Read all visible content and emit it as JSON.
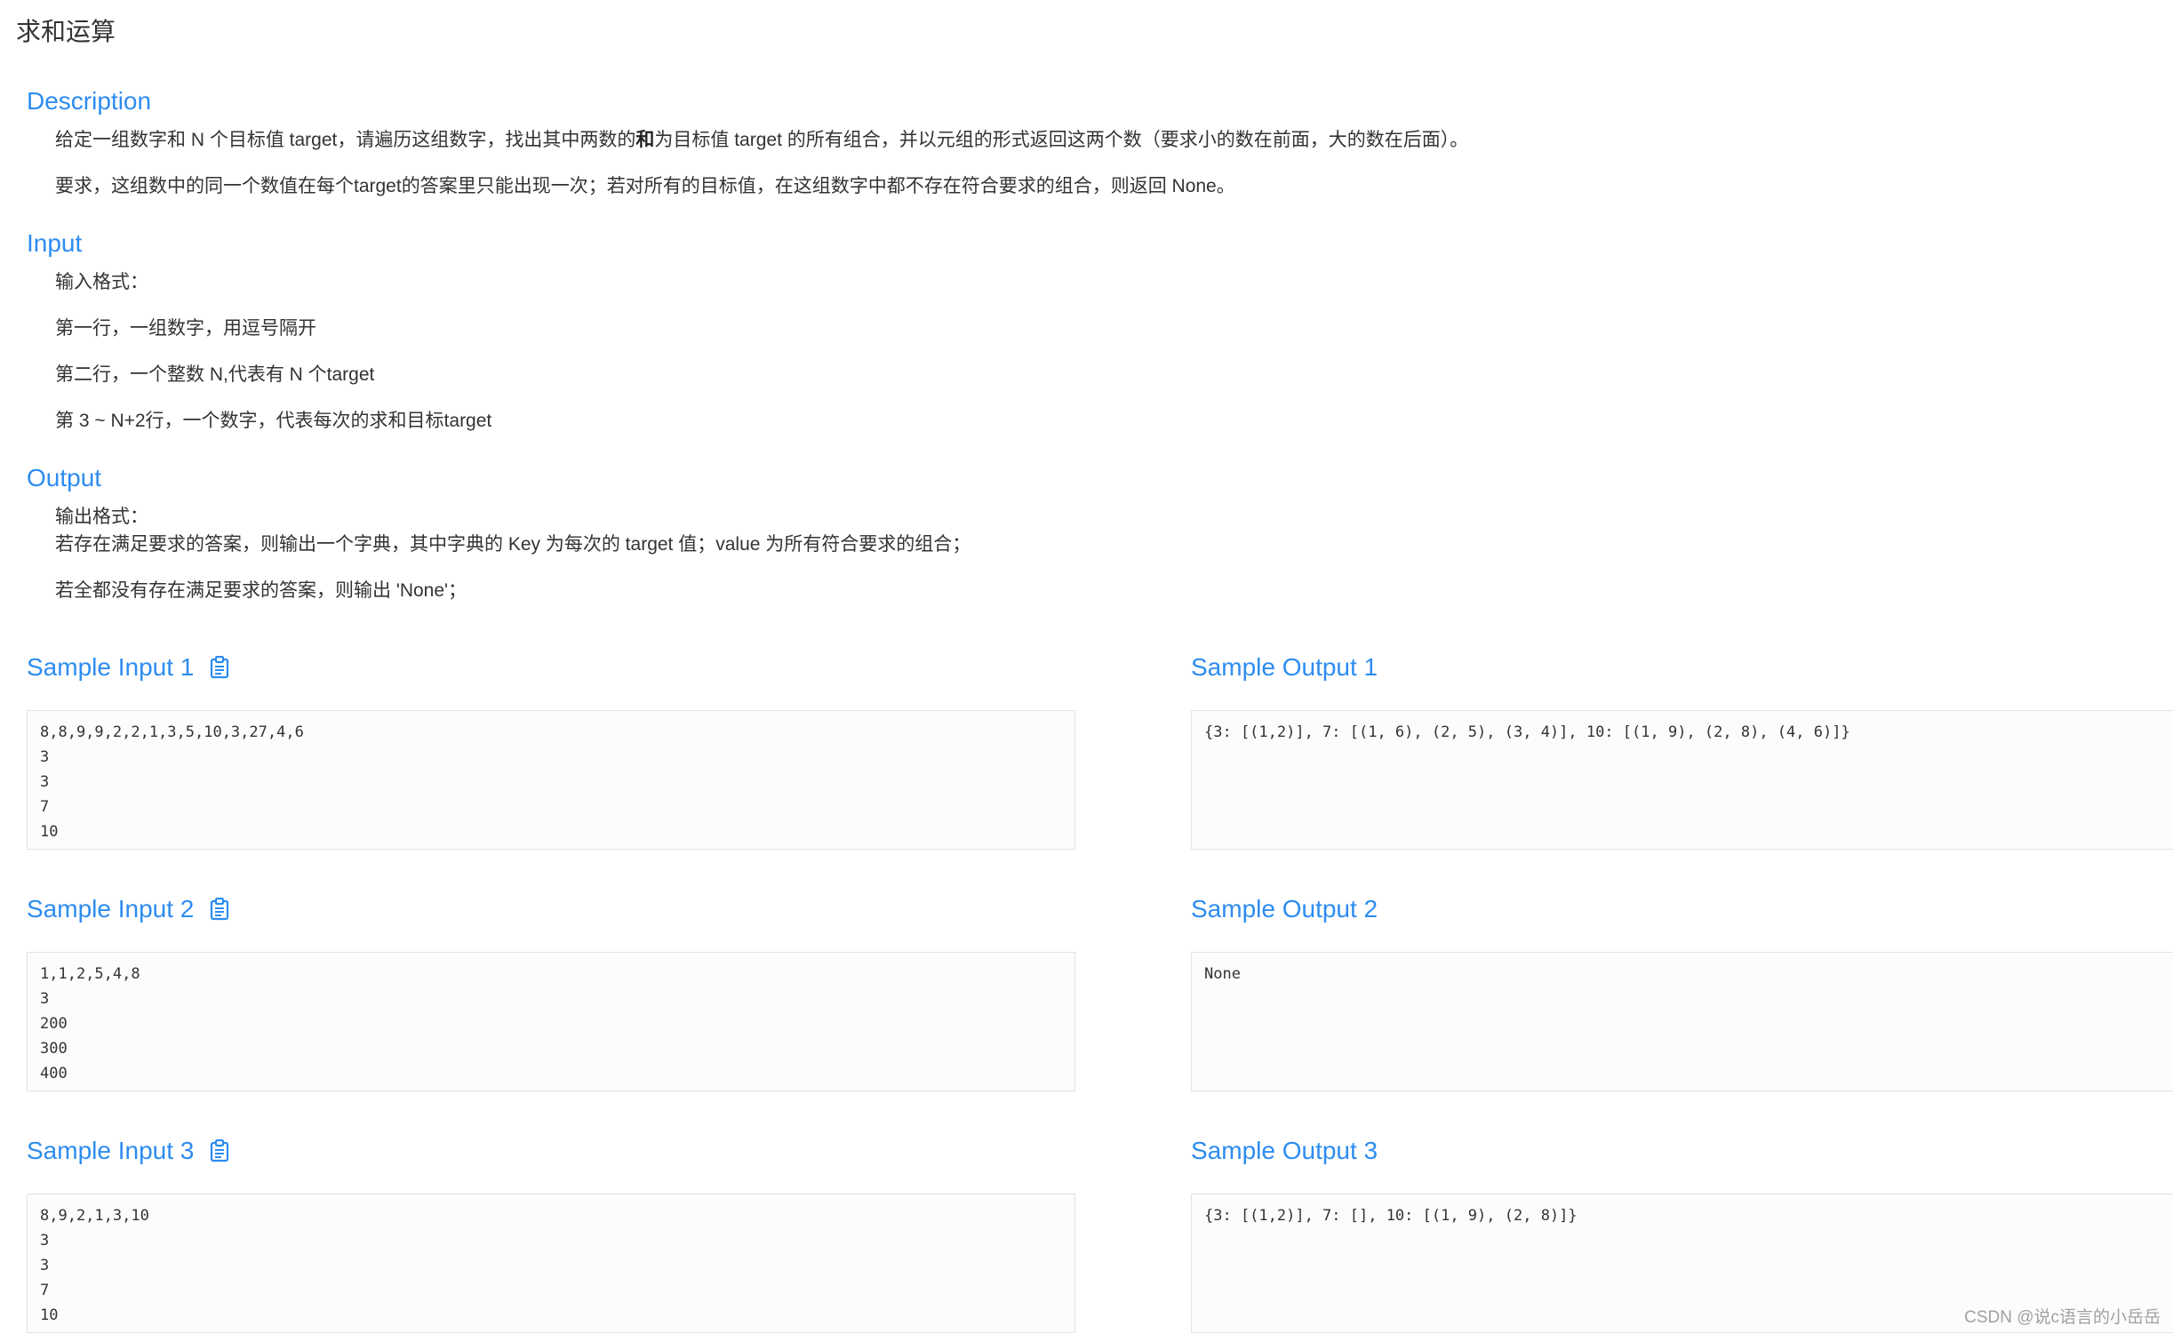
{
  "page_title": "求和运算",
  "description": {
    "title": "Description",
    "p1_before": "给定一组数字和 N 个目标值 target，请遍历这组数字，找出其中两数的",
    "p1_bold": "和",
    "p1_after": "为目标值 target  的所有组合，并以元组的形式返回这两个数（要求小的数在前面，大的数在后面）。",
    "p2": "要求，这组数中的同一个数值在每个target的答案里只能出现一次；若对所有的目标值，在这组数字中都不存在符合要求的组合，则返回 None。"
  },
  "input": {
    "title": "Input",
    "lines": [
      "输入格式：",
      "第一行，一组数字，用逗号隔开",
      "第二行，一个整数 N,代表有 N 个target",
      "第 3 ~ N+2行，一个数字，代表每次的求和目标target"
    ]
  },
  "output": {
    "title": "Output",
    "line1": "输出格式：",
    "line2": "若存在满足要求的答案，则输出一个字典，其中字典的 Key 为每次的 target 值；value 为所有符合要求的组合；",
    "line3": "若全都没有存在满足要求的答案，则输出 'None'；"
  },
  "samples": [
    {
      "input_title": "Sample Input 1",
      "output_title": "Sample Output 1",
      "input_lines": [
        "8,8,9,9,2,2,1,3,5,10,3,27,4,6",
        "3",
        "3",
        "7",
        "10"
      ],
      "output_lines": [
        "{3: [(1,2)], 7: [(1, 6), (2, 5), (3, 4)], 10: [(1, 9), (2, 8), (4, 6)]}"
      ]
    },
    {
      "input_title": "Sample Input 2",
      "output_title": "Sample Output 2",
      "input_lines": [
        "1,1,2,5,4,8",
        "3",
        "200",
        "300",
        "400"
      ],
      "output_lines": [
        "None"
      ]
    },
    {
      "input_title": "Sample Input 3",
      "output_title": "Sample Output 3",
      "input_lines": [
        "8,9,2,1,3,10",
        "3",
        "3",
        "7",
        "10"
      ],
      "output_lines": [
        "{3: [(1,2)], 7: [], 10: [(1, 9), (2, 8)]}"
      ]
    }
  ],
  "icons": {
    "copy": "clipboard-icon"
  },
  "colors": {
    "accent": "#2d8cf0",
    "text": "#333333",
    "box_border": "#e2e2e2"
  },
  "watermark": "CSDN @说c语言的小岳岳"
}
